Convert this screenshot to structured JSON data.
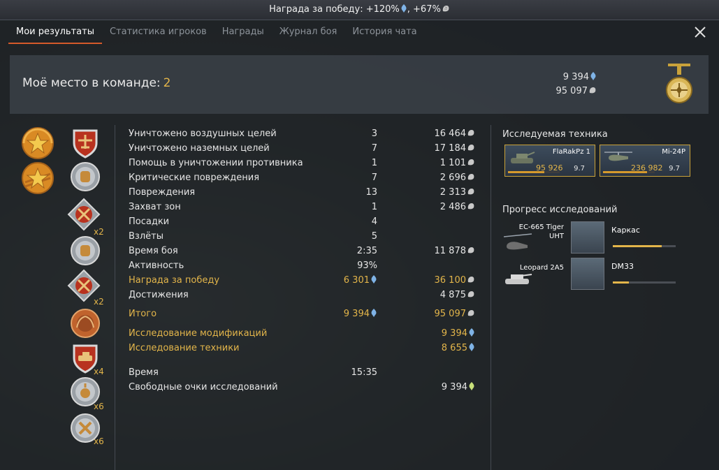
{
  "banner": {
    "text": "Награда за победу: +120%",
    "suffix": ", +67%"
  },
  "tabs": [
    {
      "label": "Мои результаты",
      "active": true
    },
    {
      "label": "Статистика игроков",
      "active": false
    },
    {
      "label": "Награды",
      "active": false
    },
    {
      "label": "Журнал боя",
      "active": false
    },
    {
      "label": "История чата",
      "active": false
    }
  ],
  "summary": {
    "place_label": "Моё место в команде:",
    "place_value": "2",
    "rp_total": "9 394",
    "sl_total": "95 097"
  },
  "awards": {
    "multipliers": [
      "x2",
      "x2",
      "x4",
      "x6",
      "x6"
    ]
  },
  "stats": [
    {
      "label": "Уничтожено воздушных целей",
      "c1": "3",
      "c2": "16 464",
      "c2_icon": "sl"
    },
    {
      "label": "Уничтожено наземных целей",
      "c1": "7",
      "c2": "17 184",
      "c2_icon": "sl"
    },
    {
      "label": "Помощь в уничтожении противника",
      "c1": "1",
      "c2": "1 101",
      "c2_icon": "sl"
    },
    {
      "label": "Критические повреждения",
      "c1": "7",
      "c2": "2 696",
      "c2_icon": "sl"
    },
    {
      "label": "Повреждения",
      "c1": "13",
      "c2": "2 313",
      "c2_icon": "sl"
    },
    {
      "label": "Захват зон",
      "c1": "1",
      "c2": "2 486",
      "c2_icon": "sl"
    },
    {
      "label": "Посадки",
      "c1": "4",
      "c2": ""
    },
    {
      "label": "Взлёты",
      "c1": "5",
      "c2": ""
    },
    {
      "label": "Время боя",
      "c1": "2:35",
      "c2": "11 878",
      "c2_icon": "sl"
    },
    {
      "label": "Активность",
      "c1": "93%",
      "c2": ""
    },
    {
      "label": "Награда за победу",
      "c1": "6 301",
      "c1_icon": "rp",
      "c2": "36 100",
      "c2_icon": "sl",
      "gold": true
    },
    {
      "label": "Достижения",
      "c1": "",
      "c2": "4 875",
      "c2_icon": "sl"
    }
  ],
  "total": {
    "label": "Итого",
    "rp": "9 394",
    "sl": "95 097"
  },
  "research": [
    {
      "label": "Исследование модификаций",
      "value": "9 394"
    },
    {
      "label": "Исследование техники",
      "value": "8 655"
    }
  ],
  "time": {
    "label": "Время",
    "value": "15:35"
  },
  "free_rp": {
    "label": "Свободные очки исследований",
    "value": "9 394"
  },
  "researched_vehicles": {
    "title": "Исследуемая техника",
    "items": [
      {
        "name": "FlaRakPz 1",
        "exp": "95 926",
        "br": "9.7",
        "progress": 0.7
      },
      {
        "name": "Mi-24P",
        "exp": "236 982",
        "br": "9.7",
        "progress": 0.85
      }
    ]
  },
  "research_progress": {
    "title": "Прогресс исследований",
    "items": [
      {
        "vehicle": "EC-665 Tiger UHT",
        "module": "Каркас",
        "progress": 0.78
      },
      {
        "vehicle": "Leopard 2A5",
        "module": "DM33",
        "progress": 0.26
      }
    ]
  },
  "colors": {
    "accent": "#d55a2a",
    "gold": "#e3b54a",
    "rp_blue": "#7fb3e6",
    "sl_silver": "#c8c8c8",
    "free_rp": "#c8e07a"
  }
}
